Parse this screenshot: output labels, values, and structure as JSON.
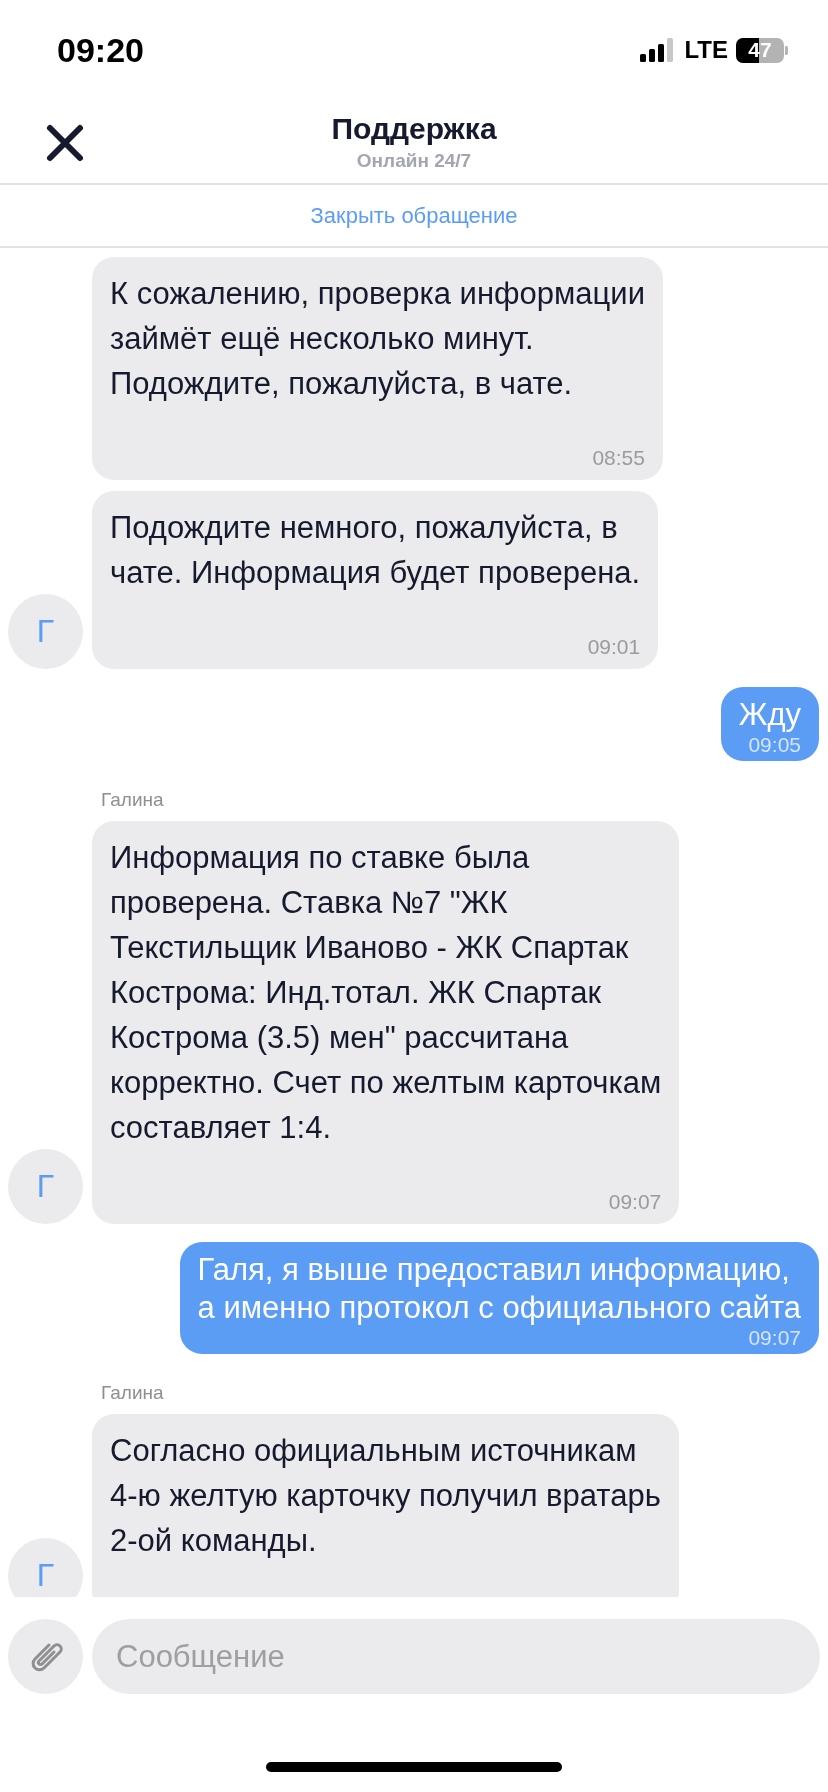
{
  "status_bar": {
    "time": "09:20",
    "network": "LTE",
    "battery": "47"
  },
  "header": {
    "title": "Поддержка",
    "subtitle": "Онлайн 24/7",
    "close_request": "Закрыть обращение"
  },
  "messages": [
    {
      "kind": "incoming",
      "text": "К сожалению, проверка информации\nзаймёт ещё несколько минут.\nПодождите, пожалуйста, в чате.",
      "time": "08:55"
    },
    {
      "kind": "incoming",
      "text": "Подождите немного, пожалуйста, в\nчате. Информация будет проверена.",
      "time": "09:01",
      "avatar": "Г"
    },
    {
      "kind": "outgoing",
      "text": "Жду",
      "time": "09:05"
    },
    {
      "kind": "incoming",
      "sender": "Галина",
      "text": "Информация по ставке была\nпроверена. Ставка №7 \"ЖК\nТекстильщик Иваново - ЖК Спартак\nКострома: Инд.тотал. ЖК Спартак\nКострома (3.5) мен\" рассчитана\nкорректно. Счет по желтым карточкам\nсоставляет 1:4.",
      "time": "09:07",
      "avatar": "Г"
    },
    {
      "kind": "outgoing",
      "text": "Галя, я выше предоставил информацию,\nа именно протокол с официального сайта",
      "time": "09:07"
    },
    {
      "kind": "incoming",
      "sender": "Галина",
      "text": "Согласно официальным источникам\n4-ю желтую карточку получил вратарь\n2-ой команды.",
      "avatar": "Г"
    }
  ],
  "composer": {
    "placeholder": "Сообщение"
  }
}
